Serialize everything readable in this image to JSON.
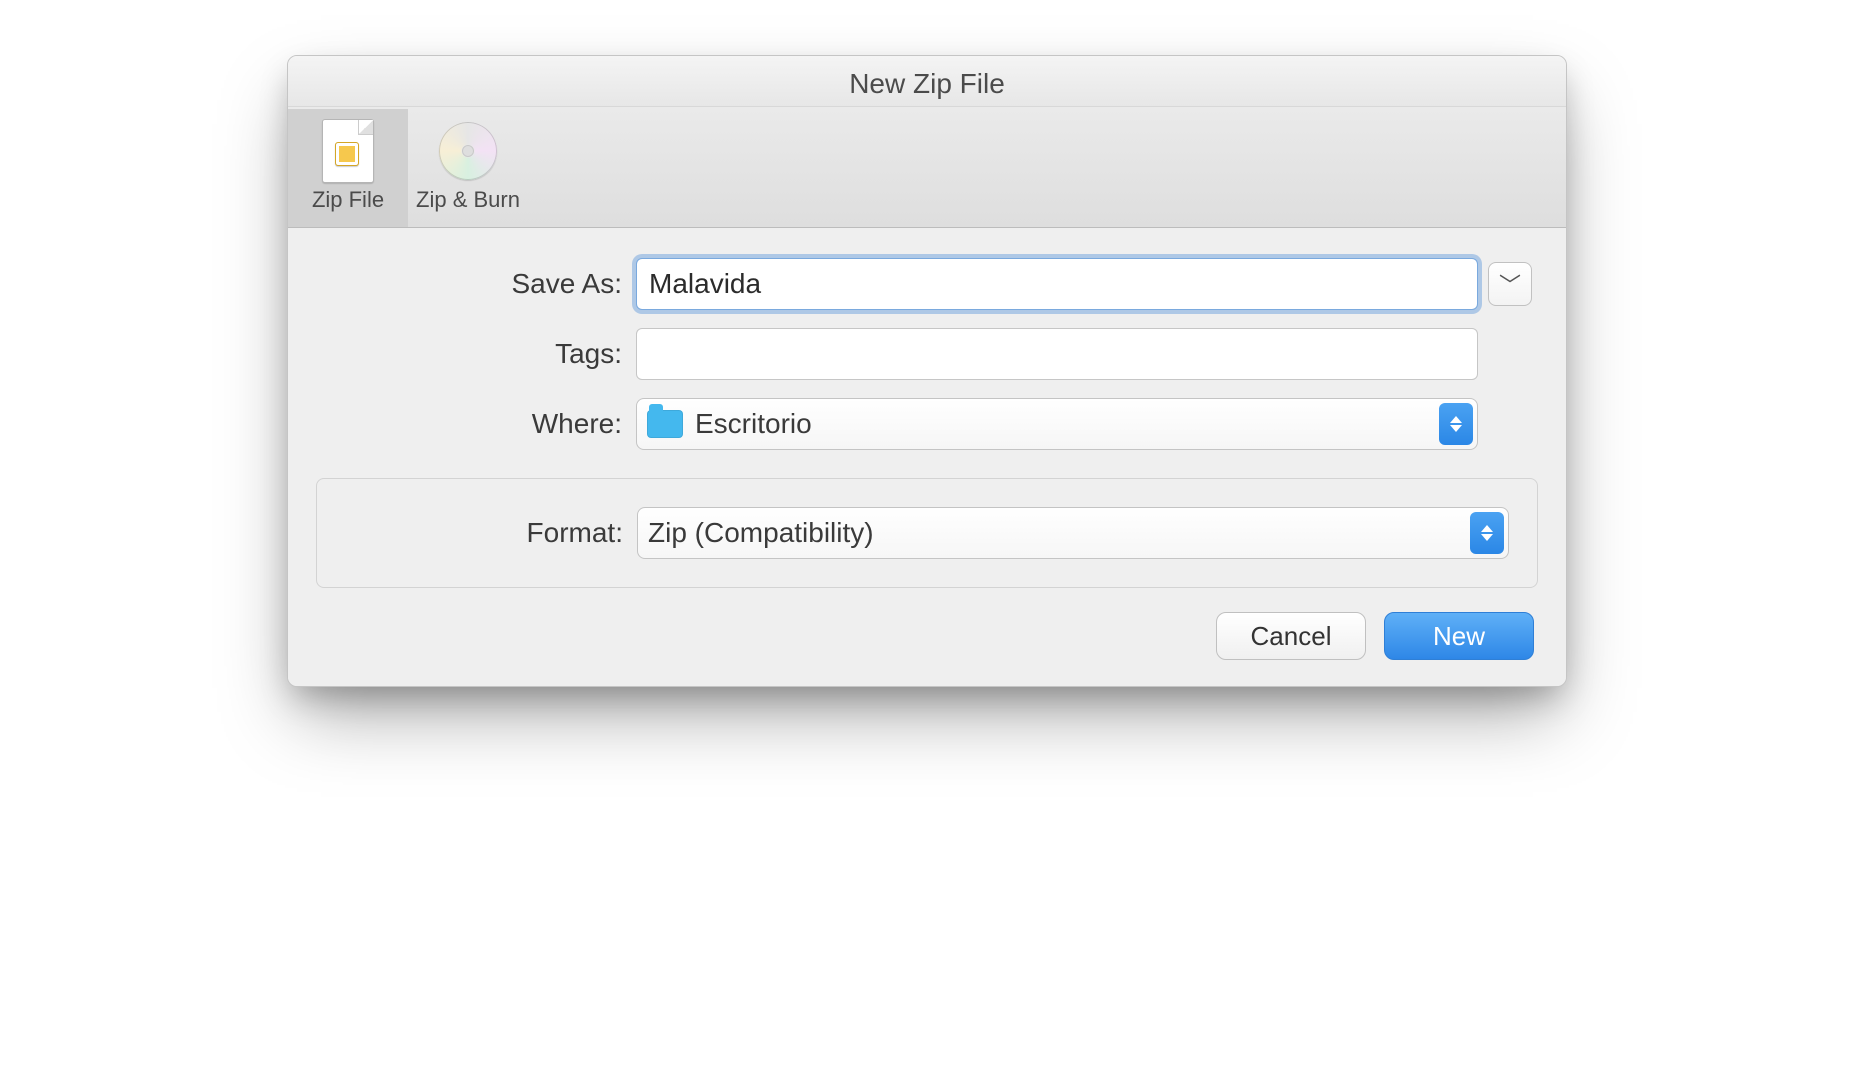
{
  "window": {
    "title": "New Zip File"
  },
  "toolbar": {
    "items": [
      {
        "label": "Zip File",
        "icon": "zipfile-icon",
        "selected": true
      },
      {
        "label": "Zip & Burn",
        "icon": "disc-icon",
        "selected": false
      }
    ]
  },
  "form": {
    "save_as": {
      "label": "Save As:",
      "value": "Malavida"
    },
    "tags": {
      "label": "Tags:",
      "value": ""
    },
    "where": {
      "label": "Where:",
      "value": "Escritorio",
      "icon": "folder-icon"
    },
    "format": {
      "label": "Format:",
      "value": "Zip (Compatibility)"
    }
  },
  "buttons": {
    "expand_tooltip": "Expand",
    "cancel": "Cancel",
    "new": "New"
  },
  "colors": {
    "accent": "#2e87e7",
    "focus_ring": "#78a8de"
  }
}
